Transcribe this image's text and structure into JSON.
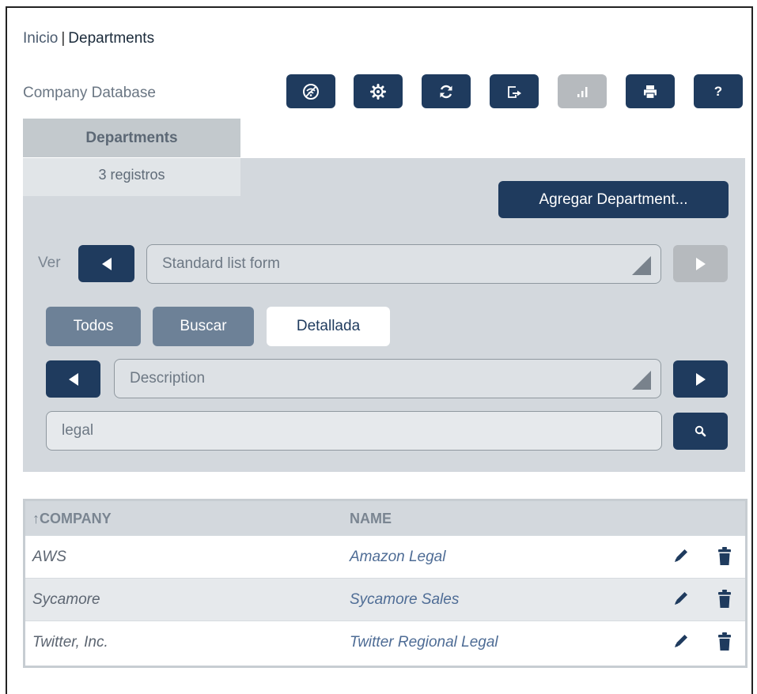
{
  "breadcrumb": {
    "home": "Inicio",
    "separator": "|",
    "current": "Departments"
  },
  "header": {
    "db_name": "Company Database"
  },
  "toolbar": {
    "buttons": [
      {
        "icon": "no-wifi-icon",
        "enabled": true
      },
      {
        "icon": "gear-icon",
        "enabled": true
      },
      {
        "icon": "refresh-icon",
        "enabled": true
      },
      {
        "icon": "export-icon",
        "enabled": true
      },
      {
        "icon": "chart-icon",
        "enabled": false
      },
      {
        "icon": "print-icon",
        "enabled": true
      },
      {
        "icon": "help-icon",
        "label": "?",
        "enabled": true
      }
    ]
  },
  "tab": {
    "label": "Departments",
    "records": "3 registros"
  },
  "actions": {
    "add_label": "Agregar Department..."
  },
  "view": {
    "label": "Ver",
    "selected": "Standard list form"
  },
  "filter_modes": {
    "all": "Todos",
    "search": "Buscar",
    "detailed": "Detallada",
    "active": "Detallada"
  },
  "field_select": {
    "selected": "Description"
  },
  "search": {
    "value": "legal"
  },
  "table": {
    "columns": [
      "↑COMPANY",
      "NAME"
    ],
    "rows": [
      {
        "company": "AWS",
        "name": "Amazon Legal"
      },
      {
        "company": "Sycamore",
        "name": "Sycamore Sales"
      },
      {
        "company": "Twitter, Inc.",
        "name": "Twitter Regional Legal"
      }
    ]
  },
  "colors": {
    "primary": "#1f3b5e",
    "panel": "#d3d8dd",
    "disabled": "#b6babe",
    "link": "#4e6c95"
  }
}
